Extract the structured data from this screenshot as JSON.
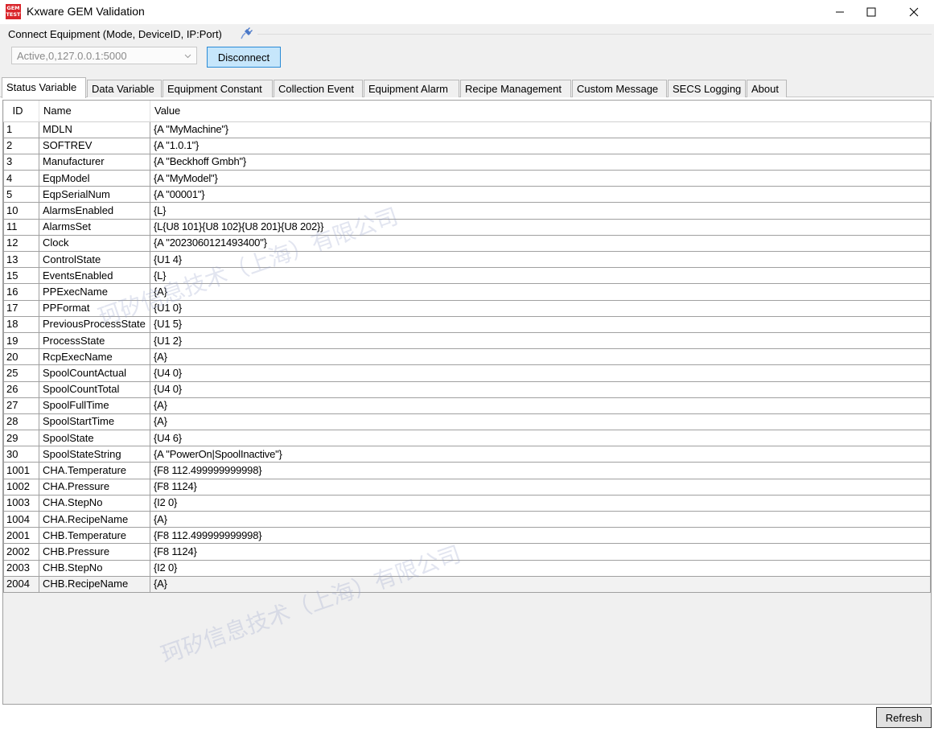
{
  "window": {
    "title": "Kxware GEM Validation",
    "icon_lines": [
      "GEM",
      "TEST"
    ]
  },
  "connect": {
    "group_label": "Connect Equipment (Mode, DeviceID, IP:Port)",
    "equipment_value": "Active,0,127.0.0.1:5000",
    "disconnect_label": "Disconnect"
  },
  "tabs": [
    {
      "label": "Status Variable",
      "active": true
    },
    {
      "label": "Data Variable"
    },
    {
      "label": "Equipment Constant"
    },
    {
      "label": "Collection Event"
    },
    {
      "label": "Equipment Alarm"
    },
    {
      "label": "Recipe Management"
    },
    {
      "label": "Custom Message"
    },
    {
      "label": "SECS Logging"
    },
    {
      "label": "About"
    }
  ],
  "table": {
    "columns": [
      "ID",
      "Name",
      "Value"
    ],
    "rows": [
      [
        "1",
        "MDLN",
        "{A \"MyMachine\"}"
      ],
      [
        "2",
        "SOFTREV",
        "{A \"1.0.1\"}"
      ],
      [
        "3",
        "Manufacturer",
        "{A \"Beckhoff Gmbh\"}"
      ],
      [
        "4",
        "EqpModel",
        "{A \"MyModel\"}"
      ],
      [
        "5",
        "EqpSerialNum",
        "{A \"00001\"}"
      ],
      [
        "10",
        "AlarmsEnabled",
        "{L}"
      ],
      [
        "11",
        "AlarmsSet",
        "{L{U8 101}{U8 102}{U8 201}{U8 202}}"
      ],
      [
        "12",
        "Clock",
        "{A \"2023060121493400\"}"
      ],
      [
        "13",
        "ControlState",
        "{U1 4}"
      ],
      [
        "15",
        "EventsEnabled",
        "{L}"
      ],
      [
        "16",
        "PPExecName",
        "{A}"
      ],
      [
        "17",
        "PPFormat",
        "{U1 0}"
      ],
      [
        "18",
        "PreviousProcessState",
        "{U1 5}"
      ],
      [
        "19",
        "ProcessState",
        "{U1 2}"
      ],
      [
        "20",
        "RcpExecName",
        "{A}"
      ],
      [
        "25",
        "SpoolCountActual",
        "{U4 0}"
      ],
      [
        "26",
        "SpoolCountTotal",
        "{U4 0}"
      ],
      [
        "27",
        "SpoolFullTime",
        "{A}"
      ],
      [
        "28",
        "SpoolStartTime",
        "{A}"
      ],
      [
        "29",
        "SpoolState",
        "{U4 6}"
      ],
      [
        "30",
        "SpoolStateString",
        "{A \"PowerOn|SpoolInactive\"}"
      ],
      [
        "1001",
        "CHA.Temperature",
        "{F8 112.499999999998}"
      ],
      [
        "1002",
        "CHA.Pressure",
        "{F8 1124}"
      ],
      [
        "1003",
        "CHA.StepNo",
        "{I2 0}"
      ],
      [
        "1004",
        "CHA.RecipeName",
        "{A}"
      ],
      [
        "2001",
        "CHB.Temperature",
        "{F8 112.499999999998}"
      ],
      [
        "2002",
        "CHB.Pressure",
        "{F8 1124}"
      ],
      [
        "2003",
        "CHB.StepNo",
        "{I2 0}"
      ],
      [
        "2004",
        "CHB.RecipeName",
        "{A}"
      ]
    ]
  },
  "refresh_label": "Refresh",
  "watermarks": [
    "珂矽信息技术（上海）有限公司",
    "珂矽信息技术（上海）有限公司"
  ],
  "colors": {
    "disconnect_bg": "#c6e6fb",
    "disconnect_border": "#2a8bd6",
    "icon_red": "#d9252b"
  }
}
